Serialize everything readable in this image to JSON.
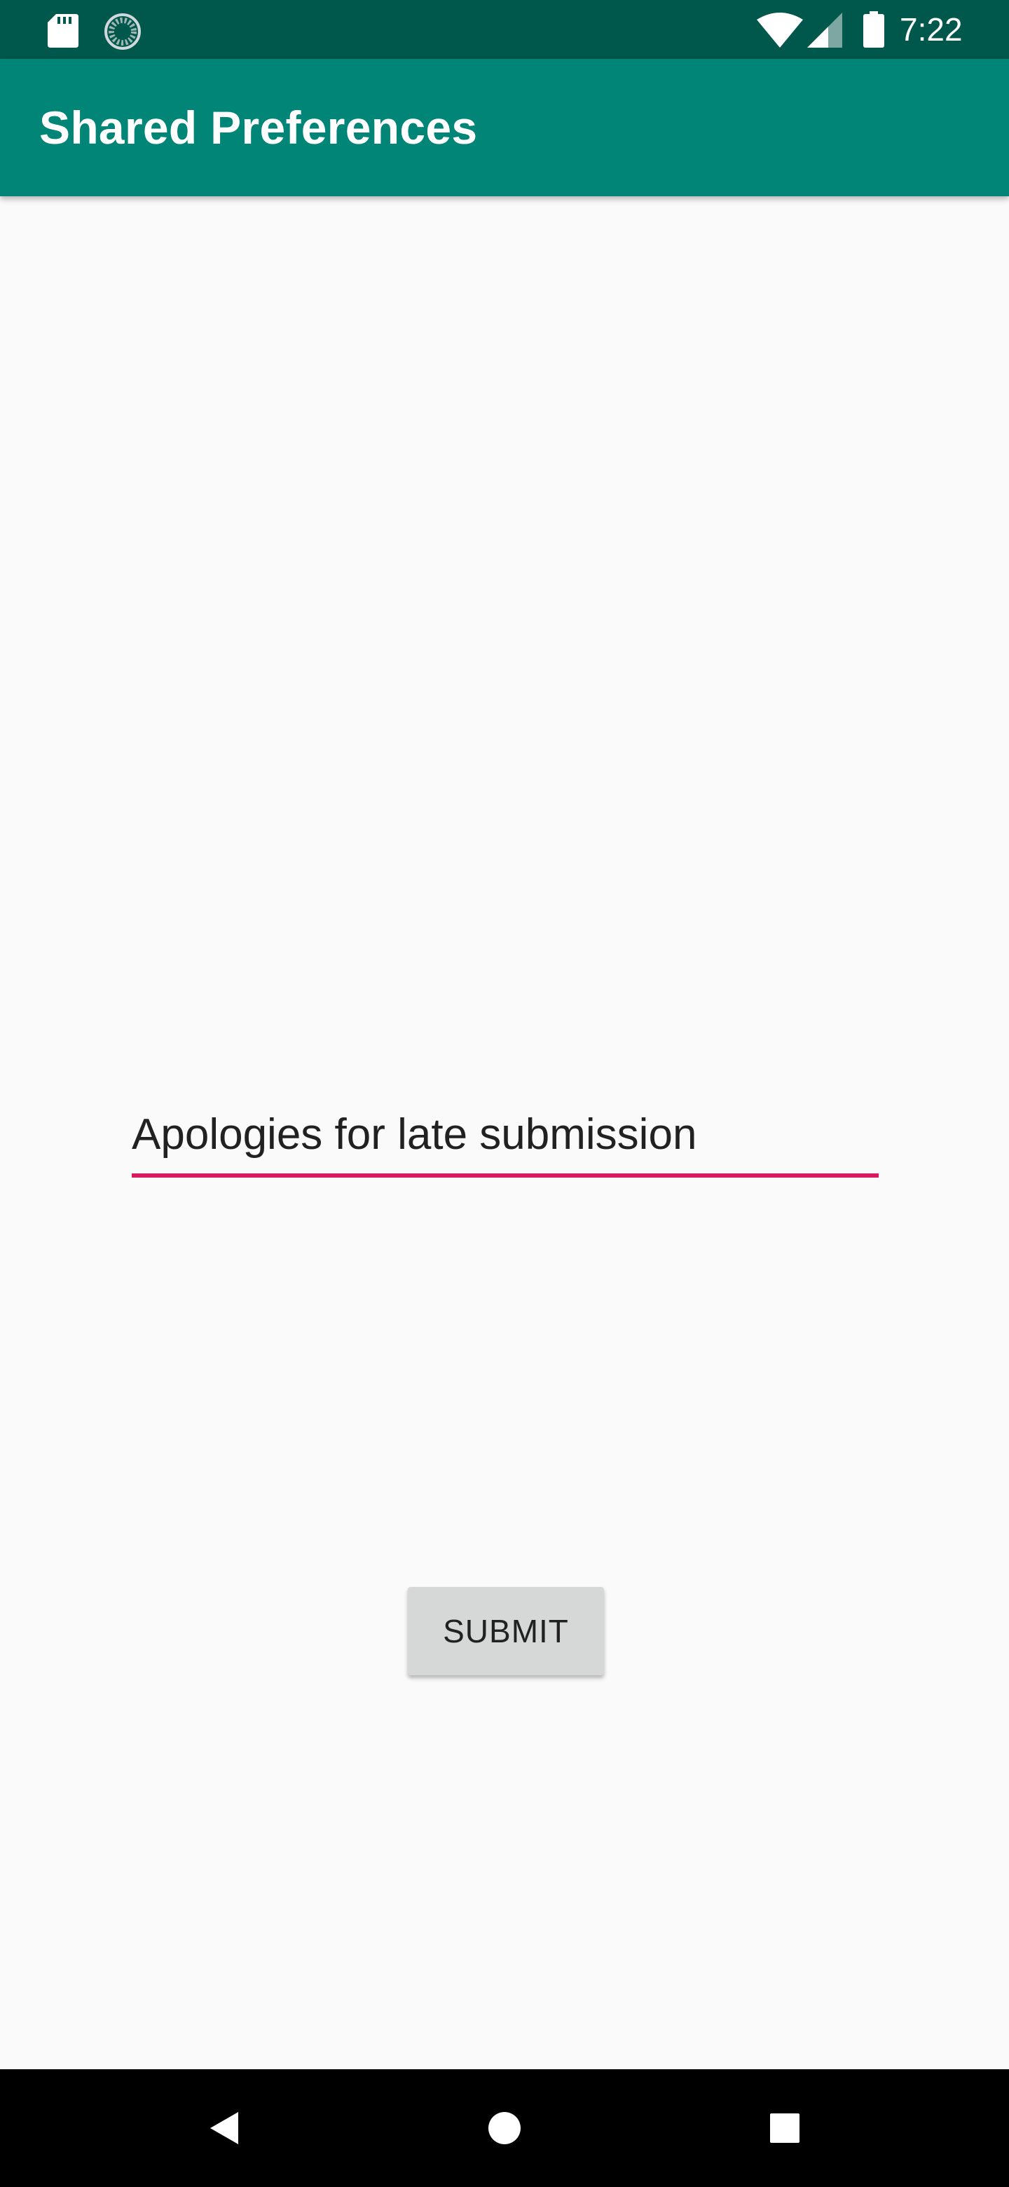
{
  "status_bar": {
    "time": "7:22",
    "icons": [
      "sd-card-icon",
      "sync-icon",
      "wifi-icon",
      "signal-icon",
      "battery-icon"
    ],
    "background_color": "#00574b"
  },
  "app_bar": {
    "title": "Shared Preferences",
    "background_color": "#008577"
  },
  "form": {
    "message_input_value": "Apologies for late submission",
    "underline_color": "#d81b60",
    "submit_label": "SUBMIT"
  },
  "nav_bar": {
    "icons": [
      "back-icon",
      "home-icon",
      "recents-icon"
    ]
  }
}
